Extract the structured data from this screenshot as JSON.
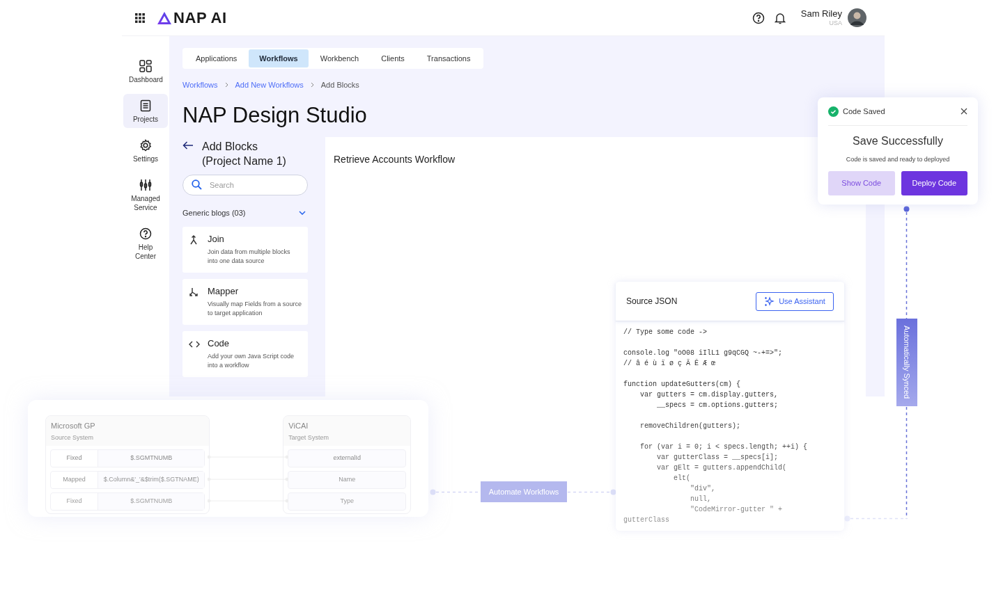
{
  "header": {
    "logo_text": "NAP AI",
    "user": {
      "name": "Sam Riley",
      "country": "USA"
    }
  },
  "sidebar": {
    "items": [
      {
        "label": "Dashboard",
        "selected": false
      },
      {
        "label": "Projects",
        "selected": true
      },
      {
        "label": "Settings",
        "selected": false
      },
      {
        "label": "Managed Service",
        "selected": false
      },
      {
        "label": "Help Center",
        "selected": false
      }
    ]
  },
  "tabs": [
    {
      "label": "Applications",
      "selected": false
    },
    {
      "label": "Workflows",
      "selected": true
    },
    {
      "label": "Workbench",
      "selected": false
    },
    {
      "label": "Clients",
      "selected": false
    },
    {
      "label": "Transactions",
      "selected": false
    }
  ],
  "breadcrumb": [
    {
      "label": "Workflows",
      "current": false
    },
    {
      "label": "Add New Workflows",
      "current": false
    },
    {
      "label": "Add Blocks",
      "current": true
    }
  ],
  "page_title": "NAP Design Studio",
  "blocks_panel": {
    "title": "Add Blocks (Project Name 1)",
    "search": {
      "placeholder": "Search"
    },
    "group": {
      "label": "Generic blogs (03)",
      "expanded": true
    },
    "blocks": [
      {
        "title": "Join",
        "description": "Join data from multiple blocks into one data source"
      },
      {
        "title": "Mapper",
        "description": "Visually map Fields from a source to target application"
      },
      {
        "title": "Code",
        "description": "Add your own Java Script code into a workflow"
      }
    ]
  },
  "canvas": {
    "title": "Retrieve Accounts Workflow"
  },
  "source_json": {
    "title": "Source JSON",
    "assistant_button": "Use Assistant",
    "code_blocks": [
      [
        "// Type some code ->"
      ],
      [
        "console.log \"oO08 iIlL1 g9qCGQ ~-+=>\";",
        "// â é ù ï ø ç Ã Ē Æ œ"
      ],
      [
        "function updateGutters(cm) {",
        "    var gutters = cm.display.gutters,",
        "        __specs = cm.options.gutters;"
      ],
      [
        "    removeChildren(gutters);"
      ],
      [
        "    for (var i = 0; i < specs.length; ++i) {",
        "        var gutterClass = __specs[i];",
        "        var gElt = gutters.appendChild(",
        "            elt(",
        "                \"div\",",
        "                null,",
        "                \"CodeMirror-gutter \" +",
        "gutterClass"
      ]
    ]
  },
  "toast": {
    "status": "Code Saved",
    "heading": "Save Successfully",
    "message": "Code is saved and ready to deployed",
    "buttons": [
      {
        "label": "Show Code",
        "kind": "secondary"
      },
      {
        "label": "Deploy Code",
        "kind": "primary"
      }
    ]
  },
  "sync_label": "Automatically Synced",
  "automate_label": "Automate Workflows",
  "mapping": {
    "source": {
      "name": "Microsoft GP",
      "subtitle": "Source System"
    },
    "target": {
      "name": "ViCAI",
      "subtitle": "Target System"
    },
    "rows": [
      {
        "mode": "Fixed",
        "source_field": "$.SGMTNUMB",
        "target_field": "externalId"
      },
      {
        "mode": "Mapped",
        "source_field": "$.Column&'_'&$trim($.SGTNAME)",
        "target_field": "Name"
      },
      {
        "mode": "Fixed",
        "source_field": "$.SGMTNUMB",
        "target_field": "Type"
      }
    ]
  }
}
